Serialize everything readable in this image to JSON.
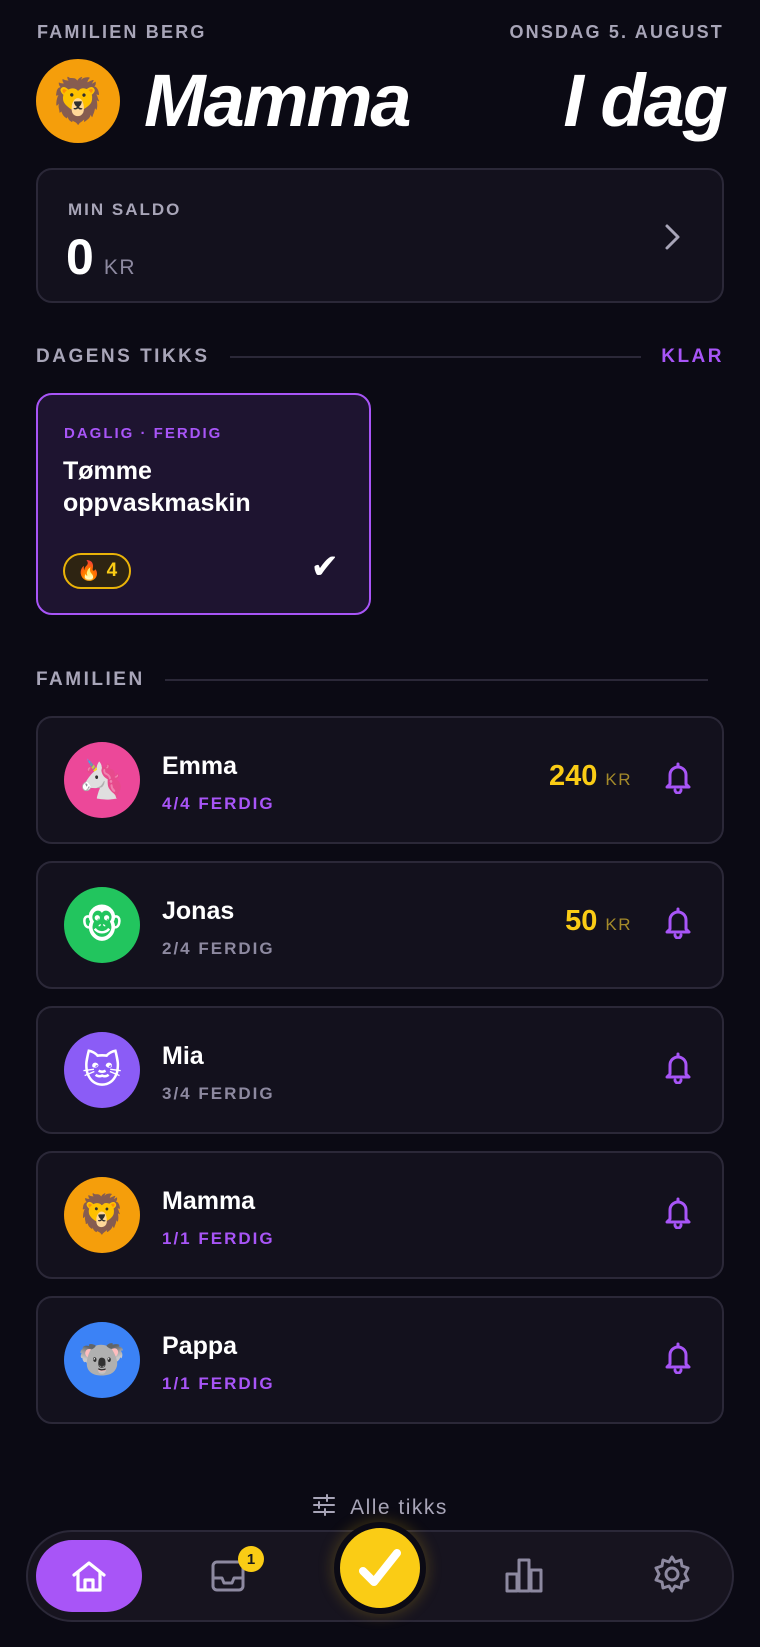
{
  "header": {
    "family_name": "FAMILIEN BERG",
    "date": "ONSDAG 5. AUGUST",
    "user_name": "Mamma",
    "user_emoji": "🦁",
    "today_label": "I dag"
  },
  "balance": {
    "label": "MIN SALDO",
    "value": "0",
    "unit": "KR"
  },
  "today_section": {
    "title": "DAGENS TIKKS",
    "action": "KLAR"
  },
  "task": {
    "meta": "DAGLIG · FERDIG",
    "title": "Tømme oppvaskmaskin",
    "streak_icon": "🔥",
    "streak_count": "4",
    "check": "✔"
  },
  "family_section": {
    "title": "FAMILIEN"
  },
  "members": [
    {
      "name": "Emma",
      "emoji": "🦄",
      "progress": "4/4 FERDIG",
      "amount": "240",
      "unit": "KR",
      "avatar_color": "#ec4899",
      "progress_color": "#a855f7"
    },
    {
      "name": "Jonas",
      "emoji": "🐵",
      "progress": "2/4 FERDIG",
      "amount": "50",
      "unit": "KR",
      "avatar_color": "#22c55e",
      "progress_color": "#8d89a0"
    },
    {
      "name": "Mia",
      "emoji": "🐱",
      "progress": "3/4 FERDIG",
      "avatar_color": "#8b5cf6",
      "progress_color": "#8d89a0"
    },
    {
      "name": "Mamma",
      "emoji": "🦁",
      "progress": "1/1 FERDIG",
      "avatar_color": "#f59e0b",
      "progress_color": "#a855f7"
    },
    {
      "name": "Pappa",
      "emoji": "🐨",
      "progress": "1/1 FERDIG",
      "avatar_color": "#3b82f6",
      "progress_color": "#a855f7"
    }
  ],
  "footer": {
    "all_tasks": "Alle tikks",
    "inbox_badge": "1"
  },
  "colors": {
    "accent": "#a855f7",
    "gold": "#facc15",
    "background": "#0b0a14"
  }
}
